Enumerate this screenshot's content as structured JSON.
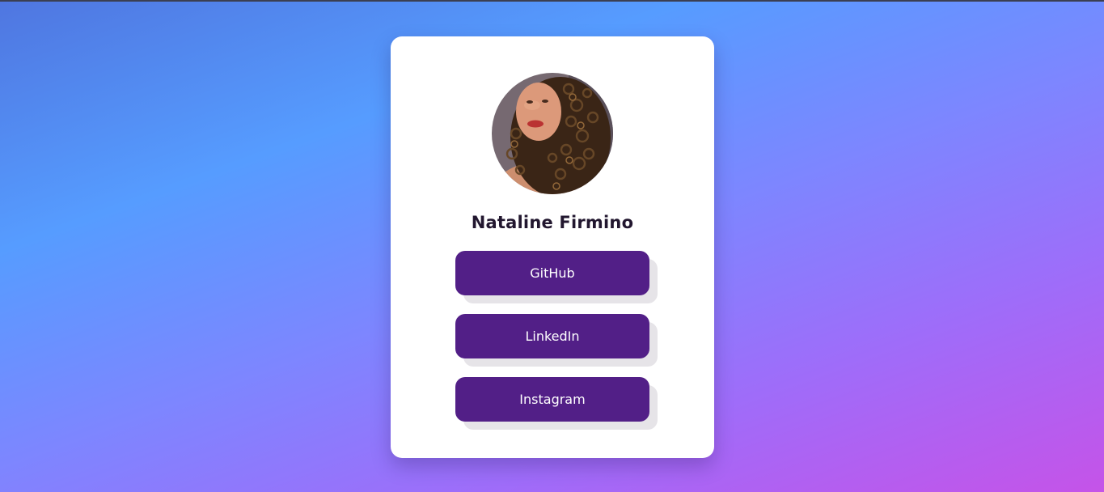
{
  "profile": {
    "name": "Nataline Firmino",
    "avatar_icon": "profile-photo"
  },
  "links": [
    {
      "label": "GitHub"
    },
    {
      "label": "LinkedIn"
    },
    {
      "label": "Instagram"
    }
  ],
  "colors": {
    "button": "#521f87",
    "button_shadow": "#e6e4e8",
    "card": "#ffffff",
    "name_text": "#22172f",
    "gradient_start": "#569cff",
    "gradient_end": "#c553e8"
  }
}
